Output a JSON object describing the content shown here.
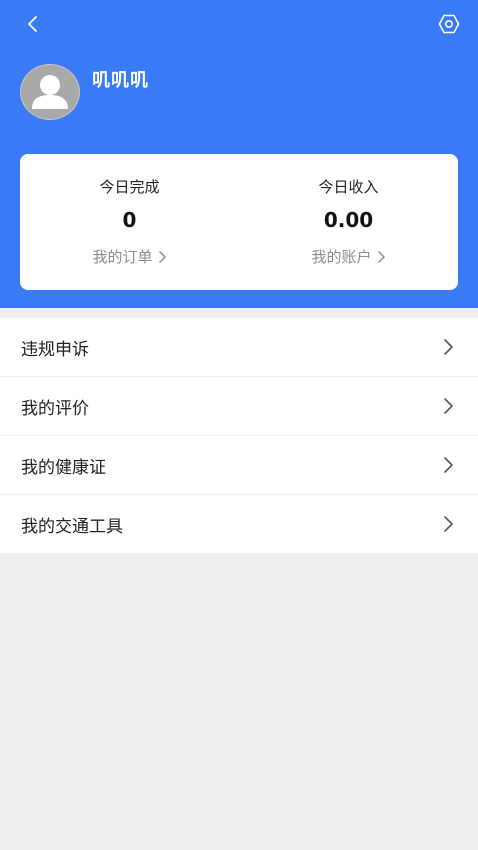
{
  "header": {
    "back_icon": "chevron-left-icon",
    "settings_icon": "gear-icon",
    "username": "叽叽叽",
    "avatar_icon": "user-avatar-icon",
    "background_color": "#3b7af6"
  },
  "stats": {
    "completed": {
      "label": "今日完成",
      "value": "0",
      "link_label": "我的订单"
    },
    "income": {
      "label": "今日收入",
      "value": "0.00",
      "link_label": "我的账户"
    }
  },
  "menu": {
    "items": [
      {
        "label": "违规申诉"
      },
      {
        "label": "我的评价"
      },
      {
        "label": "我的健康证"
      },
      {
        "label": "我的交通工具"
      }
    ]
  }
}
